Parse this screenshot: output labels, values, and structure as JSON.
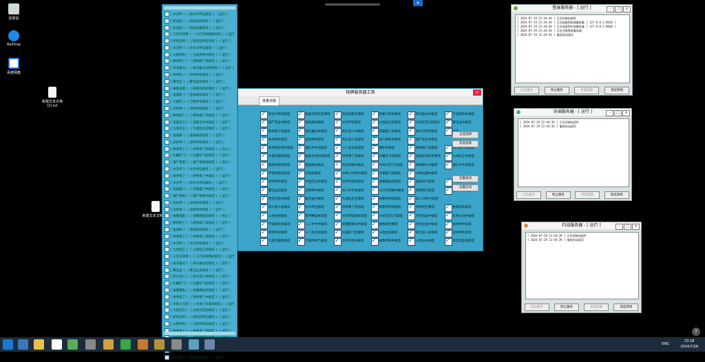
{
  "desktop": {
    "icons": [
      {
        "label": "回收站",
        "icon": "recycle-bin-icon"
      },
      {
        "label": "RaiDrop",
        "icon": "raidrop-icon"
      },
      {
        "label": "百度网盘",
        "icon": "baidu-netdisk-icon"
      },
      {
        "label": "新建文本文档 (2).txt",
        "icon": "text-file-icon"
      },
      {
        "label": "新建文本文档.txt",
        "icon": "text-file-icon"
      }
    ]
  },
  "list_panel": {
    "rows": [
      "[ 水浒传 ] - [ 新水浒传征服塔 ] - [ 运行 ]",
      "[ 新仙侠 ] - [ 新仙侠封神塔 ] - [ 运行 ]",
      "[ 新仙侠 ] - [ 新仙侠蓬莱塔 ] - [ 运行 ]",
      "[ 三打白骨精 ] - [ 三打白骨精炼狱塔 ] - [ 运行 ]",
      "[ 新轮回传 ] - [ 新轮回传修罗塔 ] - [ 运行 ]",
      "[ 水浒传 ] - [ 新水浒传征服塔 ] - [ 运行 ]",
      "[ 九阴传奇 ] - [ 九阴传奇中级塔 ] - [ 运行 ]",
      "[ 麻将麻了 ] - [ 麻将麻了麻雀塔 ] - [ 运行 ]",
      "[ 倚天屠龙 ] - [ 倚天屠龙光明顶塔 ] - [ 运行 ]",
      "[ 财神到 ] - [ 财神到中级塔 ] - [ 运行 ]",
      "[ 聚宝盆 ] - [ 聚宝盆初级塔 ] - [ 运行 ]",
      "[ 咏春白鹤 ] - [ 咏春白鹤初级塔 ] - [ 运行 ]",
      "[ 金瓶梅 ] - [ 金瓶梅高级塔 ] - [ 运行 ]",
      "[ 万图传 ] - [ 万图传中级塔 ] - [ 运行 ]",
      "[ 武财神 ] - [ 武财神初级塔 ] - [ 运行 ]",
      "[ 麻将胡了 ] - [ 麻将胡了中级塔 ] - [ 运行 ]",
      "[ 美猴宝马 ] - [ 美猴宝马中级塔 ] - [ 运行 ]",
      "[ 九线拉王 ] - [ 九线拉王初级塔 ] - [ 运行 ]",
      "[ 金瓶梅 ] - [ 金瓶梅高级塔 ] - [ 运行 ]",
      "[ 武财神 ] - [ 武财神初级塔 ] - [ 运行 ]",
      "[ 财神来了 ] - [ 财神来了初级塔 ] - [ 停止 ]",
      "[ 比翼双飞 ] - [ 比翼双飞初级塔 ] - [ 运行 ]",
      "[ 僵尸来袭 ] - [ 僵尸来袭初级塔 ] - [ 运行 ]",
      "[ 水浒传 ] - [ 水浒传征服塔 ] - [ 运行 ]",
      "[ 财神来了 ] - [ 财神来了中级塔 ] - [ 运行 ]",
      "[ 水浒传 ] - [ 新水浒传初级塔 ] - [ 运行 ]",
      "[ 双喜临门 ] - [ 双喜临门中级塔 ] - [ 运行 ]",
      "[ 僵尸来袭 ] - [ 僵尸来袭中级塔 ] - [ 运行 ]",
      "[ 武财神 ] - [ 武财神高级塔 ] - [ 运行 ]",
      "[ 武财神 ] - [ 武财神中级塔 ] - [ 运行 ]",
      "[ 金蟾捕鱼 ] - [ 金蟾捕鱼初级塔 ] - [ 停止 ]",
      "[ 麻将胡了 ] - [ 麻将胡了高级塔 ] - [ 运行 ]",
      "[ 金瓶梅 ] - [ 金瓶梅高级塔 ] - [ 运行 ]",
      "[ 财神来了 ] - [ 财神来了高级塔 ] - [ 运行 ]",
      "[ 水浒传 ] - [ 水浒传初级塔 ] - [ 运行 ]",
      "[ 九线拉王 ] - [ 九线拉王高级塔 ] - [ 运行 ]",
      "[ 三打白骨精 ] - [ 三打白骨精初级塔 ] - [ 运行 ]",
      "[ 倚天屠龙 ] - [ 倚天屠龙初级塔 ] - [ 运行 ]",
      "[ 聚宝盆 ] - [ 聚宝盆高级塔 ] - [ 运行 ]",
      "[ 四大美人 ] - [ 四大美人中级塔 ] - [ 运行 ]",
      "[ 比翼双飞 ] - [ 比翼双飞高级塔 ] - [ 运行 ]",
      "[ 金蟾捕鱼 ] - [ 金蟾捕鱼高级塔 ] - [ 运行 ]",
      "[ 财神来了 ] - [ 财神来了中级塔 ] - [ 运行 ]",
      "[ 水果小玛丽 ] - [ 水果小玛丽高级塔 ] - [ 运行 ]",
      "[ 大闹天宫 ] - [ 大闹天宫初级塔 ] - [ 运行 ]",
      "[ 新轮回传 ] - [ 新轮回传征服塔 ] - [ 运行 ]",
      "[ 九阴传奇 ] - [ 九阴传奇高级塔 ] - [ 运行 ]",
      "[ 财神来了 ] - [ 财神来了初级塔 ] - [ 运行 ]",
      "[ 新轮回传 ] - [ 新轮回传初级塔 ] - [ 运行 ]",
      "[ 红男大战 ] - [ 红男大战中级塔 ] - [ 运行 ]",
      "[ 大闹天宫 ] - [ 大闹天宫中级塔 ] - [ 运行 ]",
      "[ 水浒传 ] - [ 水浒传初级塔 ] - [ 运行 ]"
    ]
  },
  "tool_window": {
    "title": "桃牌服务器工具",
    "close_label": "×",
    "tab_label": "批量关服",
    "grid": [
      "新水浒传初级塔",
      "猛鹿老虎机至尊塔",
      "欢乐探秘至尊塔",
      "智鹿三得中级塔",
      "倚天屠龙中级塔",
      "千道修炼中级塔",
      "僵尸先生中级塔",
      "金瓶梅高级塔",
      "水浒传征服塔",
      "九线拉王初级塔",
      "大闹天宫1初级塔",
      "聚宝盆中级塔",
      "麻将胡了初级塔",
      "倚天屠龙中级塔",
      "四大美人中级塔",
      "双喜临门中级塔",
      "新水浒传高级塔",
      "全选",
      "财神到中级塔",
      "武财神初级塔",
      "四大美人初级塔",
      "四人麻将中级塔",
      "僵尸先生中级塔",
      "",
      "财神到红拜中级塔",
      "通比牛牛初级塔",
      "十二生肖初级塔",
      "两轮中级塔",
      "麻将胡了高级塔",
      "四大美人初级塔",
      "水果拉霸初级塔",
      "猛鹿老虎机初级塔",
      "财神来了高级塔",
      "比翼双飞初级塔",
      "猛鹿老虎机至尊塔",
      "九线拉王中级塔",
      "狐妖财神初级塔",
      "金瓶梅初级塔",
      "欢乐探秘中级塔",
      "大闹天宫1千级塔",
      "财神解扎中级塔",
      "通比牛牛高级塔",
      "宇道修炼初级塔",
      "欢迎初级塔",
      "水果小玛丽中级塔",
      "双喜临门初级塔",
      "水果拉霸中级塔",
      "",
      "财神到中级塔",
      "中国宝马中级塔",
      "连环夺宝初级塔",
      "金蟾捕鱼初级塔",
      "狐妖财千级塔",
      "九连宝中级塔",
      "聚宝盆初级塔",
      "武财神中级塔",
      "四人牛牛初级塔",
      "三打白骨精中级塔",
      "财神到万级塔",
      "猛鹿老虎机至尊塔",
      "月亮宝盒中级塔",
      "聚宝盆中级塔",
      "九线拉王至尊塔",
      "秘鲁传奇初级塔",
      "四人30秒中级塔",
      "",
      "四大美人初级塔",
      "水浒传征服塔",
      "财神来了体验塔",
      "秘鲁传奇高级塔",
      "財神到至尊塔",
      "妖狐新高级塔",
      "斗地主初级塔",
      "雷神赛迪体验塔",
      "水浒传征服体验塔",
      "大闹天宫1万级塔",
      "月亮宝盒中级塔",
      "红男大战中级塔",
      "宇道修炼初级塔",
      "二人牛牛中级塔",
      "新疆刮刮乐中级塔",
      "金瓶梅至尊塔",
      "月亮宝盒中级塔",
      "武财神中级塔",
      "财神到初级塔",
      "十二生肖初级塔",
      "比翼双飞至尊塔",
      "斗地主高级塔",
      "四大美人初级塔",
      "武财神体验塔",
      "九道宝藏高级塔",
      "万图传奇万级塔",
      "连环夺宝中级塔",
      "秘鲁传奇中级塔",
      "斗地主中级塔",
      "月亮宝盒高级塔"
    ],
    "side_buttons": [
      "全选选择",
      "反选选择",
      "设置关闭",
      "设置启动"
    ]
  },
  "login_server": {
    "title": "登录服务器 - [ 运行 ]",
    "logs": [
      "[ 2024-07-29 22:44:44 ] 正在初始化组件",
      "[ 2024-07-29 22:44:44 ] 正在连接到协调服务器 [ 127.0.0.1:8610 ]",
      "[ 2024-07-29 22:44:44 ] 正在连接到约战服务器 [ 127.0.0.1:8640 ]",
      "[ 2024-07-29 22:44:44 ] 正在注册登录服务器",
      "[ 2024-07-29 22:44:44 ] 服务启动成功"
    ],
    "buttons": [
      "启动服务",
      "停止服务",
      "系统配置",
      "退出系统"
    ]
  },
  "coord_server": {
    "title": "协调服务器 - [ 运行 ]",
    "logs": [
      "[ 2024-07-29 22:44:34 ] 正在初始化组件",
      "[ 2024-07-29 22:44:34 ] 服务启动成功"
    ],
    "buttons": [
      "启动服务",
      "停止服务",
      "系统配置",
      "退出系统"
    ]
  },
  "battle_server": {
    "title": "约战服务器 - [ 运行 ]",
    "logs": [
      "[ 2024-07-29 22:44:39 ] 正在初始化组件",
      "[ 2024-07-29 22:44:39 ] 服务启动成功"
    ],
    "buttons": [
      "启动服务",
      "停止服务",
      "系统配置",
      "退出系统"
    ]
  },
  "taskbar": {
    "ime": "ENG",
    "time": "23:28",
    "date": "2024/7/28"
  },
  "help_label": "?"
}
